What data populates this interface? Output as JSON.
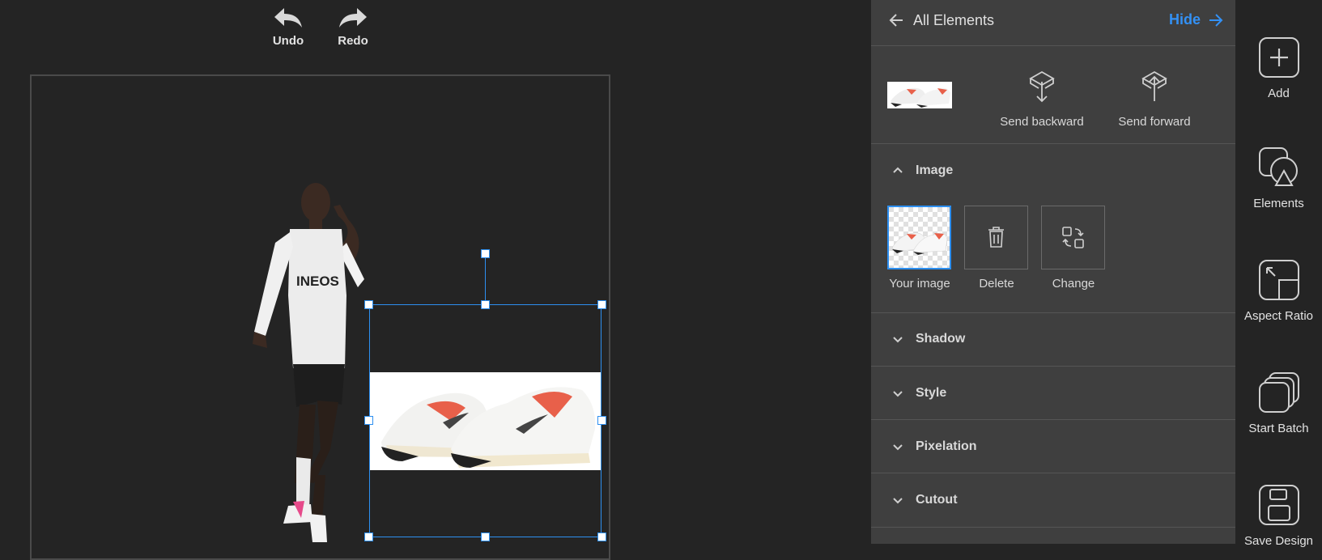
{
  "toolbar": {
    "undo_label": "Undo",
    "redo_label": "Redo"
  },
  "panel": {
    "title": "All Elements",
    "hide_label": "Hide",
    "send_backward_label": "Send backward",
    "send_forward_label": "Send forward",
    "sections": {
      "image": "Image",
      "shadow": "Shadow",
      "style": "Style",
      "pixelation": "Pixelation",
      "cutout": "Cutout"
    },
    "image_tiles": {
      "your_image": "Your image",
      "delete": "Delete",
      "change": "Change"
    }
  },
  "sidebar": {
    "add": "Add",
    "elements": "Elements",
    "aspect_ratio": "Aspect Ratio",
    "start_batch": "Start Batch",
    "save_design": "Save Design"
  },
  "canvas": {
    "runner_shirt_text": "INEOS"
  },
  "colors": {
    "accent": "#2d8ff0",
    "link": "#3391f5",
    "panel_bg": "#3f3f3f",
    "app_bg": "#242424"
  }
}
